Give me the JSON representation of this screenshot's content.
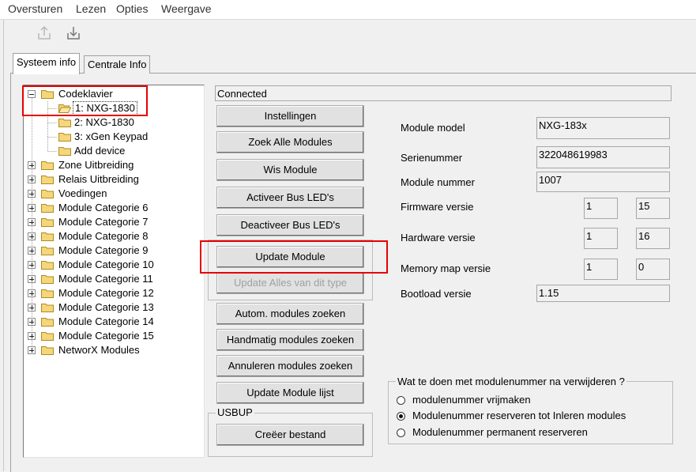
{
  "menu": [
    "Oversturen",
    "Lezen",
    "Opties",
    "Weergave"
  ],
  "toolbar": {
    "upload_icon": "upload-icon",
    "download_icon": "download-icon"
  },
  "tabs": [
    "Systeem info",
    "Centrale Info"
  ],
  "tree": {
    "root": "Codeklavier",
    "children": [
      "1: NXG-1830",
      "2: NXG-1830",
      "3: xGen Keypad",
      "Add device"
    ],
    "groups": [
      "Zone Uitbreiding",
      "Relais Uitbreiding",
      "Voedingen",
      "Module Categorie 6",
      "Module Categorie 7",
      "Module Categorie 8",
      "Module Categorie 9",
      "Module Categorie 10",
      "Module Categorie 11",
      "Module Categorie 12",
      "Module Categorie 13",
      "Module Categorie 14",
      "Module Categorie 15",
      "NetworX Modules"
    ]
  },
  "status": "Connected",
  "buttons": {
    "instellingen": "Instellingen",
    "zoek_alle": "Zoek Alle Modules",
    "wis": "Wis Module",
    "activeer": "Activeer Bus LED's",
    "deactiveer": "Deactiveer Bus LED's",
    "update_module": "Update Module",
    "update_alles": "Update Alles van dit type",
    "autom": "Autom. modules zoeken",
    "handmatig": "Handmatig modules zoeken",
    "annuleren": "Annuleren modules zoeken",
    "update_lijst": "Update Module lijst",
    "creeer": "Creëer bestand"
  },
  "usbup_title": "USBUP",
  "info": {
    "module_model_label": "Module model",
    "module_model": "NXG-183x",
    "serienummer_label": "Serienummer",
    "serienummer": "322048619983",
    "module_nummer_label": "Module nummer",
    "module_nummer": "1007",
    "firmware_label": "Firmware versie",
    "firmware_major": "1",
    "firmware_minor": "15",
    "hardware_label": "Hardware versie",
    "hardware_major": "1",
    "hardware_minor": "16",
    "memmap_label": "Memory map versie",
    "memmap_major": "1",
    "memmap_minor": "0",
    "bootload_label": "Bootload versie",
    "bootload": "1.15"
  },
  "radio_group": {
    "title": "Wat te doen met modulenummer na verwijderen ?",
    "options": [
      "modulenummer vrijmaken",
      "Modulenummer reserveren tot Inleren modules",
      "Modulenummer permanent reserveren"
    ],
    "selected_index": 1
  }
}
